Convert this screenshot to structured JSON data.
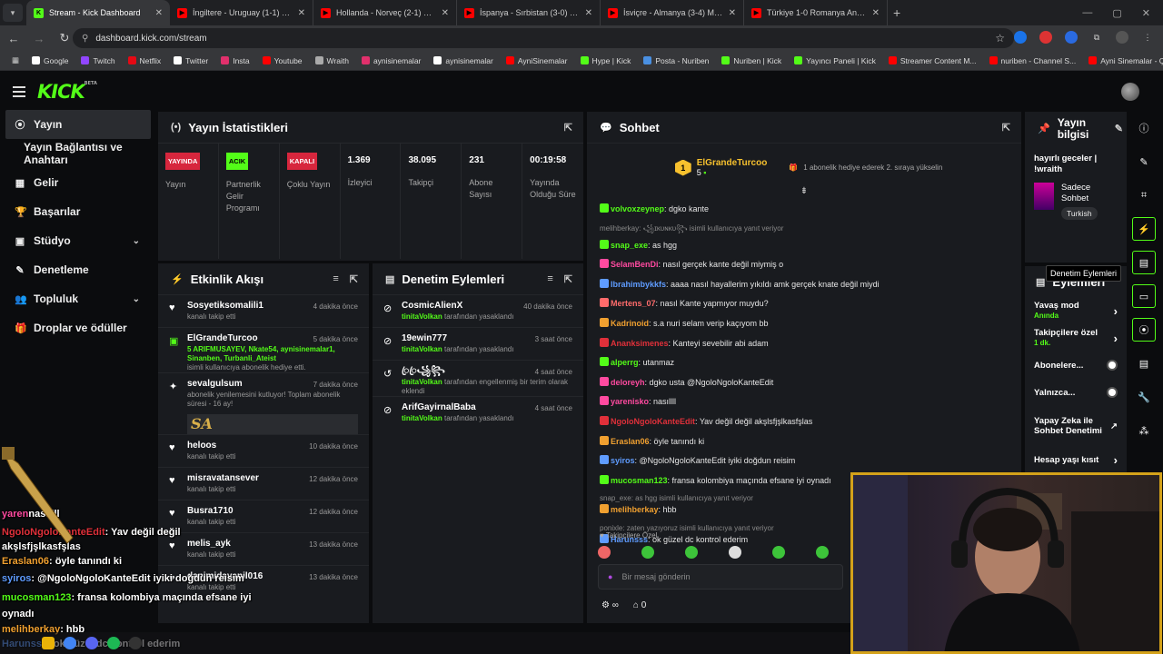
{
  "browser": {
    "tabs": [
      {
        "title": "Stream - Kick Dashboard",
        "favicon_color": "#53fc18",
        "favicon_letter": "K",
        "active": true
      },
      {
        "title": "İngiltere - Uruguay (1-1) Maç Ö",
        "favicon_color": "#ff0000",
        "favicon_letter": "▶",
        "active": false
      },
      {
        "title": "Hollanda - Norveç (2-1) Maç Öz",
        "favicon_color": "#ff0000",
        "favicon_letter": "▶",
        "active": false
      },
      {
        "title": "İspanya - Sırbistan (3-0) Maç Ö",
        "favicon_color": "#ff0000",
        "favicon_letter": "▶",
        "active": false
      },
      {
        "title": "İsviçre - Almanya (3-4) Maç Özi",
        "favicon_color": "#ff0000",
        "favicon_letter": "▶",
        "active": false
      },
      {
        "title": "Türkiye 1-0 Romanya Analizi -",
        "favicon_color": "#ff0000",
        "favicon_letter": "▶",
        "active": false
      }
    ],
    "url": "dashboard.kick.com/stream",
    "bookmarks": [
      {
        "label": "Google",
        "color": "#fff"
      },
      {
        "label": "Twitch",
        "color": "#9146ff"
      },
      {
        "label": "Netflix",
        "color": "#e50914"
      },
      {
        "label": "Twitter",
        "color": "#fff"
      },
      {
        "label": "Insta",
        "color": "#e1306c"
      },
      {
        "label": "Youtube",
        "color": "#ff0000"
      },
      {
        "label": "Wraith",
        "color": "#aaa"
      },
      {
        "label": "aynisinemalar",
        "color": "#e1306c"
      },
      {
        "label": "aynisinemalar",
        "color": "#fff"
      },
      {
        "label": "AyniSinemalar",
        "color": "#ff0000"
      },
      {
        "label": "Hype | Kick",
        "color": "#53fc18"
      },
      {
        "label": "Posta - Nuriben",
        "color": "#4a90e2"
      },
      {
        "label": "Nuriben | Kick",
        "color": "#53fc18"
      },
      {
        "label": "Yayıncı Paneli | Kick",
        "color": "#53fc18"
      },
      {
        "label": "Streamer Content M...",
        "color": "#ff0000"
      },
      {
        "label": "nuriben - Channel S...",
        "color": "#ff0000"
      },
      {
        "label": "Ayni Sinemalar - Ça...",
        "color": "#ff0000"
      }
    ]
  },
  "kick": {
    "logo": "KICK",
    "logo_sup": "BETA"
  },
  "sidebar": {
    "items": [
      {
        "label": "Yayın",
        "icon": "broadcast-icon",
        "glyph": "⦿",
        "active": true
      },
      {
        "label": "Yayın Bağlantısı ve Anahtarı",
        "icon": "",
        "glyph": "",
        "sub": true
      },
      {
        "label": "Gelir",
        "icon": "dollar-icon",
        "glyph": "▦"
      },
      {
        "label": "Başarılar",
        "icon": "trophy-icon",
        "glyph": "🏆"
      },
      {
        "label": "Stüdyo",
        "icon": "studio-icon",
        "glyph": "▣",
        "chev": true
      },
      {
        "label": "Denetleme",
        "icon": "wrench-icon",
        "glyph": "✎"
      },
      {
        "label": "Topluluk",
        "icon": "users-icon",
        "glyph": "👥",
        "chev": true
      },
      {
        "label": "Droplar ve ödüller",
        "icon": "gift-icon",
        "glyph": "🎁"
      }
    ]
  },
  "stats": {
    "title": "Yayın İstatistikleri",
    "cols": [
      {
        "badge": "YAYINDA",
        "badge_color": "#d7263d",
        "label": "Yayın"
      },
      {
        "badge": "ACIK",
        "badge_color": "#53fc18",
        "label": "Partnerlik Gelir Programı"
      },
      {
        "badge": "KAPALI",
        "badge_color": "#d7263d",
        "label": "Çoklu Yayın"
      },
      {
        "value": "1.369",
        "label": "İzleyici"
      },
      {
        "value": "38.095",
        "label": "Takipçi"
      },
      {
        "value": "231",
        "label": "Abone Sayısı"
      },
      {
        "value": "00:19:58",
        "label": "Yayında Olduğu Süre"
      }
    ]
  },
  "activity": {
    "title": "Etkinlik Akışı",
    "events": [
      {
        "icon": "heart-icon",
        "name": "Sosyetiksomalili1",
        "text": "kanalı takip etti",
        "time": "4 dakika önce"
      },
      {
        "icon": "gift-icon",
        "name": "ElGrandeTurcoo",
        "green": "5 ARIFMUSAYEV, Nkate54, aynisinemalar1, Sinanben, Turbanli_Ateist",
        "text": "isimli kullanıcıya abonelik hediye etti.",
        "time": "5 dakika önce"
      },
      {
        "icon": "star-icon",
        "name": "sevalgulsum",
        "text": "abonelik yenilemesini kutluyor! Toplam abonelik süresi - 16 ay!",
        "extra": "SA",
        "time": "7 dakika önce"
      },
      {
        "icon": "heart-icon",
        "name": "heloos",
        "text": "kanalı takip etti",
        "time": "10 dakika önce"
      },
      {
        "icon": "heart-icon",
        "name": "misravatansever",
        "text": "kanalı takip etti",
        "time": "12 dakika önce"
      },
      {
        "icon": "heart-icon",
        "name": "Busra1710",
        "text": "kanalı takip etti",
        "time": "12 dakika önce"
      },
      {
        "icon": "heart-icon",
        "name": "melis_ayk",
        "text": "kanalı takip etti",
        "time": "13 dakika önce"
      },
      {
        "icon": "heart-icon",
        "name": "danimidayanil016",
        "text": "kanalı takip etti",
        "time": "13 dakika önce"
      }
    ]
  },
  "moderation": {
    "title": "Denetim Eylemleri",
    "actions": [
      {
        "name": "CosmicAlienX",
        "by": "tinitaVolkan",
        "text": "tarafından yasaklandı",
        "time": "40 dakika önce",
        "icon": "ban-icon"
      },
      {
        "name": "19ewin777",
        "by": "tinitaVolkan",
        "text": "tarafından yasaklandı",
        "time": "3 saat önce",
        "icon": "ban-icon"
      },
      {
        "name": "ꦿꦿ꧁꧂",
        "by": "tinitaVolkan",
        "text": "tarafından engellenmiş bir terim olarak eklendi",
        "time": "4 saat önce",
        "icon": "undo-icon"
      },
      {
        "name": "ArifGayirnalBaba",
        "by": "tinitaVolkan",
        "text": "tarafından yasaklandı",
        "time": "4 saat önce",
        "icon": "ban-icon"
      }
    ]
  },
  "chat": {
    "title": "Sohbet",
    "pinned_user": "ElGrandeTurcoo",
    "pinned_count": "5",
    "pinned_note": "1 abonelik hediye ederek 2. sıraya yükselin",
    "messages": [
      {
        "user": "volvoxzeynep",
        "color": "#53fc18",
        "text": ": dgko kante"
      },
      {
        "reply": "melihberkay: ꧁ɪᴋᴜɴᴋᴜ꧂ isimli kullanıcıya yanıt veriyor",
        "user": "snap_exe",
        "color": "#53fc18",
        "text": ": as hgg"
      },
      {
        "user": "SelamBenDi",
        "color": "#ff4aa0",
        "text": ": nasıl gerçek kante değil miymiş o"
      },
      {
        "user": "Ibrahimbykkfs",
        "color": "#5f9cff",
        "text": ": aaaa nasıl hayallerim yıkıldı amk gerçek knate değil miydi"
      },
      {
        "user": "Mertens_07",
        "color": "#ff6b6b",
        "text": ": nasıl Kante yapmıyor muydu?"
      },
      {
        "user": "Kadrinoid",
        "color": "#f0a030",
        "text": ": s.a nuri selam verip kaçıyom bb"
      },
      {
        "user": "Ananksimenes",
        "color": "#e0303a",
        "text": ": Kanteyi sevebilir abi adam"
      },
      {
        "user": "alperrg",
        "color": "#53fc18",
        "text": ": utanmaz"
      },
      {
        "user": "deloreyh",
        "color": "#ff4aa0",
        "text": ": dgko usta @NgoloNgoloKanteEdit"
      },
      {
        "user": "yarenisko",
        "color": "#ff4aa0",
        "text": ": nasıllll"
      },
      {
        "user": "NgoloNgoloKanteEdit",
        "color": "#e0303a",
        "text": ": Yav değil değil akşlsfjşlkasfşlas"
      },
      {
        "user": "Eraslan06",
        "color": "#f0a030",
        "text": ": öyle tanındı ki"
      },
      {
        "user": "syiros",
        "color": "#5f9cff",
        "text": ": @NgoloNgoloKanteEdit iyiki doğdun reisim"
      },
      {
        "user": "mucosman123",
        "color": "#53fc18",
        "text": ": fransa kolombiya maçında efsane iyi oynadı"
      },
      {
        "reply": "snap_exe: as hgg isimli kullanıcıya yanıt veriyor",
        "user": "melihberkay",
        "color": "#f0a030",
        "text": ": hbb"
      },
      {
        "reply": "ponixle: zaten yazıyoruz isimli kullanıcıya yanıt veriyor",
        "user": "Harunsss",
        "color": "#5f9cff",
        "text": ": ok güzel dc kontrol ederim"
      }
    ],
    "followers_only": "Takipçilere Özel",
    "placeholder": "Bir mesaj gönderin",
    "footer_count": "0"
  },
  "stream_info": {
    "title": "Yayın bilgisi",
    "stream_title": "hayırlı geceler | !wraith",
    "category": "Sadece Sohbet",
    "tag": "Turkish"
  },
  "actions_panel": {
    "title": "Eylemleri",
    "items": [
      {
        "label": "Yavaş mod",
        "sub": "Anında",
        "control": "chevron"
      },
      {
        "label": "Takipçilere özel",
        "sub": "1 dk.",
        "control": "chevron"
      },
      {
        "label": "Abonelere...",
        "control": "toggle"
      },
      {
        "label": "Yalnızca...",
        "control": "toggle"
      },
      {
        "label": "Yapay Zeka ile Sohbet Denetimi",
        "control": "external"
      },
      {
        "label": "Hesap yaşı kısıt",
        "control": "chevron"
      }
    ]
  },
  "tooltip": "Denetim Eylemleri",
  "overlay_chat": [
    {
      "user": "yaren",
      "color": "#ff4aa0",
      "text": "nasıllll"
    },
    {
      "user": "NgoloNgoloKanteEdit",
      "color": "#e0303a",
      "text": ": Yav değil değil akşlsfjşlkasfşlas"
    },
    {
      "user": "Eraslan06",
      "color": "#f0a030",
      "text": ": öyle tanındı ki"
    },
    {
      "user": "syiros",
      "color": "#5f9cff",
      "text": ": @NgoloNgoloKanteEdit iyiki doğdun reisim"
    },
    {
      "user": "mucosman123",
      "color": "#53fc18",
      "text": ": fransa kolombiya maçında efsane iyi oynadı"
    },
    {
      "user": "melihberkay",
      "color": "#f0a030",
      "text": ": hbb"
    },
    {
      "user": "Harunsss",
      "color": "#5f9cff",
      "text": ": ok güzel dc kontrol ederim"
    }
  ],
  "colors": {
    "accent": "#53fc18",
    "panel": "#191b1f",
    "webcam_border": "#d4a21a"
  }
}
